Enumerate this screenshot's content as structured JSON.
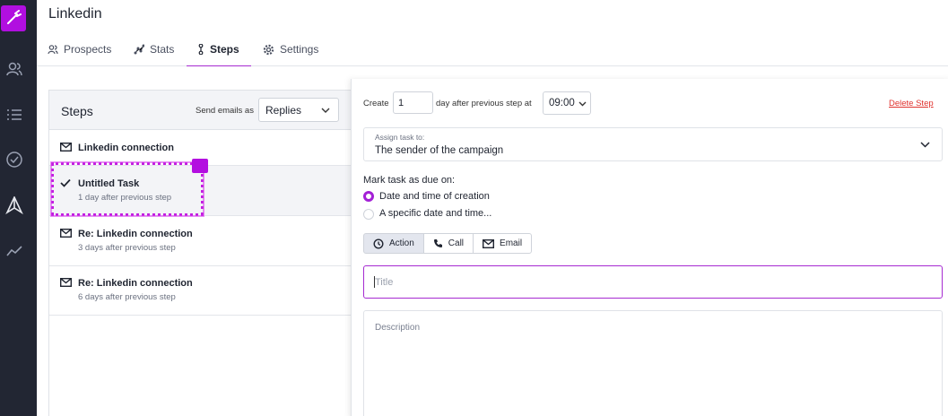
{
  "page": {
    "title": "Linkedin"
  },
  "tabs": [
    {
      "label": "Prospects",
      "icon": "users-icon"
    },
    {
      "label": "Stats",
      "icon": "stats-icon"
    },
    {
      "label": "Steps",
      "icon": "steps-icon",
      "active": true
    },
    {
      "label": "Settings",
      "icon": "gear-icon"
    }
  ],
  "steps_panel": {
    "heading": "Steps",
    "send_as_label": "Send emails as",
    "send_as_value": "Replies",
    "steps": [
      {
        "title": "Linkedin connection",
        "subtitle": "",
        "icon": "mail-icon"
      },
      {
        "title": "Untitled Task",
        "subtitle": "1 day after previous step",
        "icon": "check-icon"
      },
      {
        "title": "Re: Linkedin connection",
        "subtitle": "3 days after previous step",
        "icon": "mail-icon"
      },
      {
        "title": "Re: Linkedin connection",
        "subtitle": "6 days after previous step",
        "icon": "mail-icon"
      }
    ]
  },
  "editor": {
    "create_label": "Create",
    "create_value": "1",
    "after_label": "day after previous step at",
    "time_value": "09:00",
    "delete_label": "Delete Step",
    "assign_label": "Assign task to:",
    "assign_value": "The sender of the campaign",
    "due_label": "Mark task as due on:",
    "due_options": [
      {
        "label": "Date and time of creation",
        "selected": true
      },
      {
        "label": "A specific date and time...",
        "selected": false
      }
    ],
    "task_types": [
      {
        "label": "Action",
        "icon": "clock-icon",
        "selected": true
      },
      {
        "label": "Call",
        "icon": "phone-icon",
        "selected": false
      },
      {
        "label": "Email",
        "icon": "mail-icon",
        "selected": false
      }
    ],
    "title_placeholder": "Title",
    "description_placeholder": "Description"
  },
  "colors": {
    "accent": "#a62bd1",
    "brand": "#b10fe0",
    "rail": "#222633",
    "danger": "#e0322e"
  }
}
